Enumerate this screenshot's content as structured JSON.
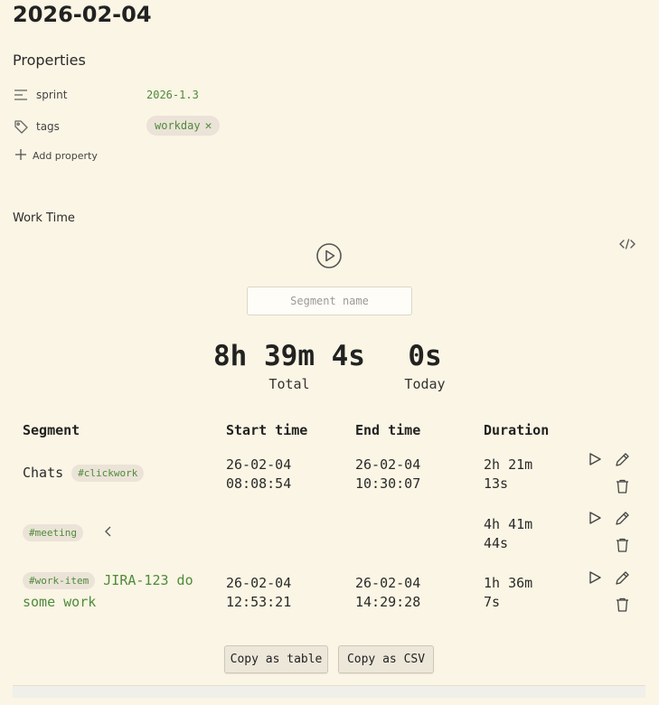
{
  "page": {
    "title": "2026-02-04"
  },
  "properties": {
    "heading": "Properties",
    "sprint": {
      "key": "sprint",
      "value": "2026-1.3"
    },
    "tags": {
      "key": "tags",
      "chips": [
        "workday"
      ]
    },
    "add_label": "Add property"
  },
  "work_time": {
    "label": "Work Time",
    "segment_placeholder": "Segment name",
    "total": {
      "value": "8h 39m 4s",
      "label": "Total"
    },
    "today": {
      "value": "0s",
      "label": "Today"
    }
  },
  "table": {
    "headers": [
      "Segment",
      "Start time",
      "End time",
      "Duration"
    ],
    "rows": [
      {
        "name": "Chats",
        "tag": "#clickwork",
        "link": "",
        "start": [
          "26-02-04",
          "08:08:54"
        ],
        "end": [
          "26-02-04",
          "10:30:07"
        ],
        "duration": [
          "2h 21m",
          "13s"
        ]
      },
      {
        "name": "",
        "tag": "#meeting",
        "link": "",
        "start": [
          "",
          ""
        ],
        "end": [
          "",
          ""
        ],
        "duration": [
          "4h 41m",
          "44s"
        ]
      },
      {
        "name": "",
        "tag": "#work-item",
        "link": "JIRA-123 do some work",
        "start": [
          "26-02-04",
          "12:53:21"
        ],
        "end": [
          "26-02-04",
          "14:29:28"
        ],
        "duration": [
          "1h 36m",
          "7s"
        ]
      }
    ]
  },
  "buttons": {
    "copy_table": "Copy as table",
    "copy_csv": "Copy as CSV"
  },
  "colors": {
    "background": "#faf5e4",
    "accent": "#4f8a3a",
    "chip": "#ebe3d7"
  }
}
